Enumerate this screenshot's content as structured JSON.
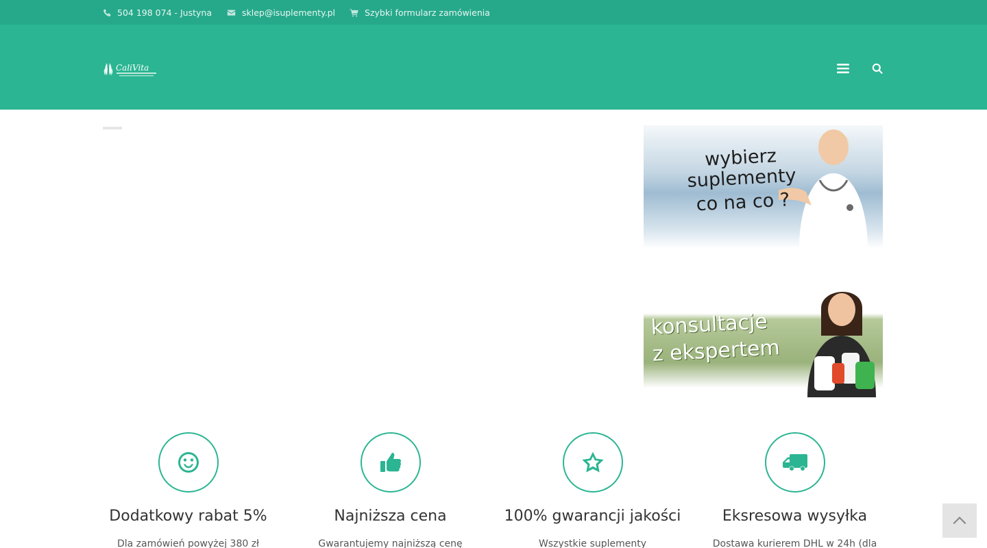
{
  "topbar": {
    "phone": "504 198 074 - Justyna",
    "email": "sklep@isuplementy.pl",
    "order_form": "Szybki formularz zamówienia"
  },
  "header": {
    "logo_text": "CaliVita"
  },
  "sidebar": {
    "banners": [
      {
        "text_line1": "wybierz suplementy",
        "text_line2": "co na co ?"
      },
      {
        "text_line1": "konsultacje",
        "text_line2": "z ekspertem"
      }
    ]
  },
  "features": [
    {
      "icon": "smile-icon",
      "title": "Dodatkowy rabat 5%",
      "text": "Dla zamówień powyżej 380 zł"
    },
    {
      "icon": "thumbs-up-icon",
      "title": "Najniższa cena",
      "text": "Gwarantujemy najniższą cenę"
    },
    {
      "icon": "star-icon",
      "title": "100% gwarancji jakości",
      "text": "Wszystkie suplementy"
    },
    {
      "icon": "truck-icon",
      "title": "Eksresowa wysyłka",
      "text": "Dostawa kurierem DHL w 24h (dla"
    }
  ],
  "colors": {
    "topbar": "#26a98a",
    "header": "#2bb592",
    "accent": "#2bb592"
  }
}
